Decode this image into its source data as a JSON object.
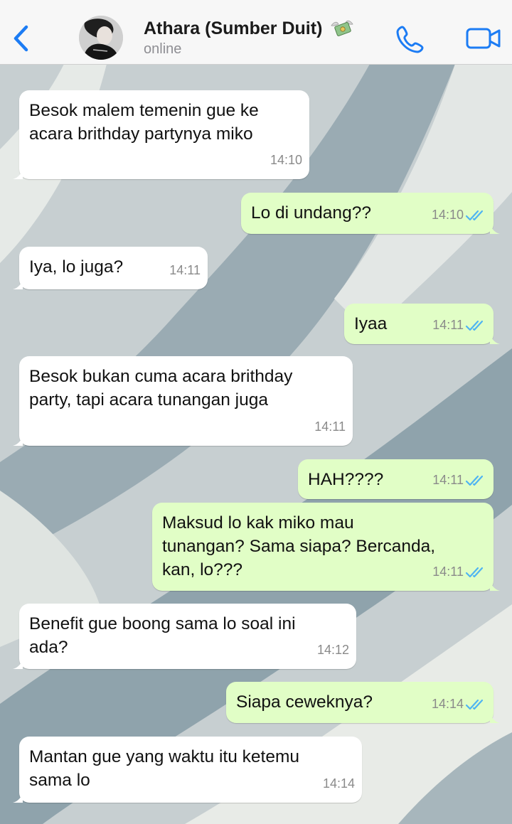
{
  "header": {
    "contact_name": "Athara (Sumber Duit)",
    "status": "online",
    "icons": {
      "back": "chevron-left-icon",
      "money": "money-with-wings-icon",
      "call": "phone-icon",
      "video": "video-camera-icon"
    }
  },
  "colors": {
    "accent": "#1c7cf4",
    "incoming_bubble": "#ffffff",
    "outgoing_bubble": "#e1fec6",
    "read_ticks": "#4fb4f2"
  },
  "messages": [
    {
      "direction": "in",
      "lines": [
        "Besok malem temenin gue ke",
        "acara brithday partynya miko"
      ],
      "time": "14:10"
    },
    {
      "direction": "out",
      "lines": [
        "Lo di undang??"
      ],
      "time": "14:10",
      "read": true
    },
    {
      "direction": "in",
      "lines": [
        "Iya, lo juga?"
      ],
      "time": "14:11"
    },
    {
      "direction": "out",
      "lines": [
        "Iyaa"
      ],
      "time": "14:11",
      "read": true
    },
    {
      "direction": "in",
      "lines": [
        "Besok bukan cuma acara brithday",
        "party, tapi acara tunangan juga"
      ],
      "time": "14:11"
    },
    {
      "direction": "out",
      "lines": [
        "HAH????"
      ],
      "time": "14:11",
      "read": true
    },
    {
      "direction": "out",
      "lines": [
        "Maksud lo kak miko mau",
        "tunangan? Sama siapa? Bercanda,",
        "kan, lo???"
      ],
      "time": "14:11",
      "read": true
    },
    {
      "direction": "in",
      "lines": [
        "Benefit gue boong sama lo soal ini",
        "ada?"
      ],
      "time": "14:12"
    },
    {
      "direction": "out",
      "lines": [
        "Siapa ceweknya?"
      ],
      "time": "14:14",
      "read": true
    },
    {
      "direction": "in",
      "lines": [
        "Mantan gue yang waktu itu ketemu",
        "sama lo"
      ],
      "time": "14:14"
    }
  ]
}
